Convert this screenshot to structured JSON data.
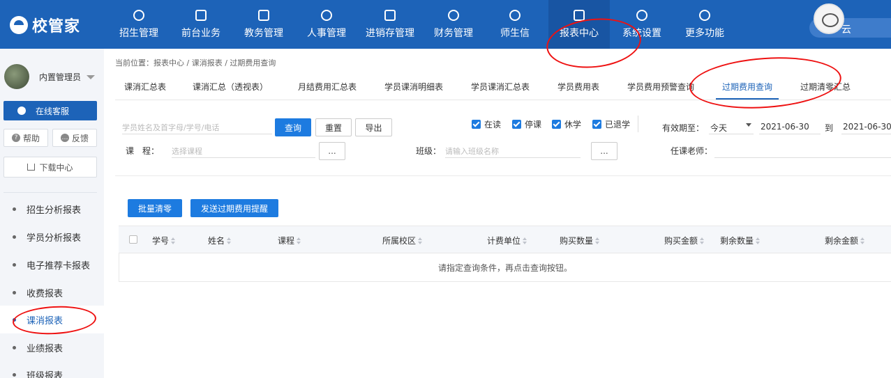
{
  "app": {
    "brand": "校管家"
  },
  "nav": [
    {
      "label": "招生管理",
      "icon": "user-plus-icon"
    },
    {
      "label": "前台业务",
      "icon": "message-icon"
    },
    {
      "label": "教务管理",
      "icon": "book-icon"
    },
    {
      "label": "人事管理",
      "icon": "user-icon"
    },
    {
      "label": "进销存管理",
      "icon": "box-arrow-icon"
    },
    {
      "label": "财务管理",
      "icon": "yen-bag-icon"
    },
    {
      "label": "师生信",
      "icon": "chat-circle-icon"
    },
    {
      "label": "报表中心",
      "icon": "chart-icon"
    },
    {
      "label": "系统设置",
      "icon": "settings-icon"
    },
    {
      "label": "更多功能",
      "icon": "more-icon"
    }
  ],
  "user": {
    "name_fragment": "云"
  },
  "sidebar": {
    "profile_name": "内置管理员",
    "online_service": "在线客服",
    "help": "帮助",
    "feedback": "反馈",
    "download_center": "下载中心",
    "menu": [
      "招生分析报表",
      "学员分析报表",
      "电子推荐卡报表",
      "收费报表",
      "课消报表",
      "业绩报表",
      "班级报表"
    ]
  },
  "breadcrumb": "当前位置：报表中心 / 课消报表 / 过期费用查询",
  "tabs": [
    "课消汇总表",
    "课消汇总（透视表）",
    "月结费用汇总表",
    "学员课消明细表",
    "学员课消汇总表",
    "学员费用表",
    "学员费用预警查询",
    "过期费用查询",
    "过期清零汇总"
  ],
  "filters": {
    "search_placeholder": "学员姓名及首字母/学号/电话",
    "query": "查询",
    "reset": "重置",
    "export": "导出",
    "statuses": [
      "在读",
      "停课",
      "休学",
      "已退学"
    ],
    "valid_until_label": "有效期至：",
    "period": "今天",
    "date_from": "2021-06-30",
    "to": "到",
    "date_to": "2021-06-30",
    "course_label": "课　程：",
    "course_placeholder": "选择课程",
    "more": "...",
    "class_label": "班级：",
    "class_placeholder": "请输入班级名称",
    "teacher_label": "任课老师："
  },
  "actions": {
    "batch_clear": "批量清零",
    "send_reminder": "发送过期费用提醒"
  },
  "table": {
    "columns": [
      "学号",
      "姓名",
      "课程",
      "所属校区",
      "计费单位",
      "购买数量",
      "购买金额",
      "剩余数量",
      "剩余金额"
    ],
    "empty": "请指定查询条件，再点击查询按钮。"
  }
}
